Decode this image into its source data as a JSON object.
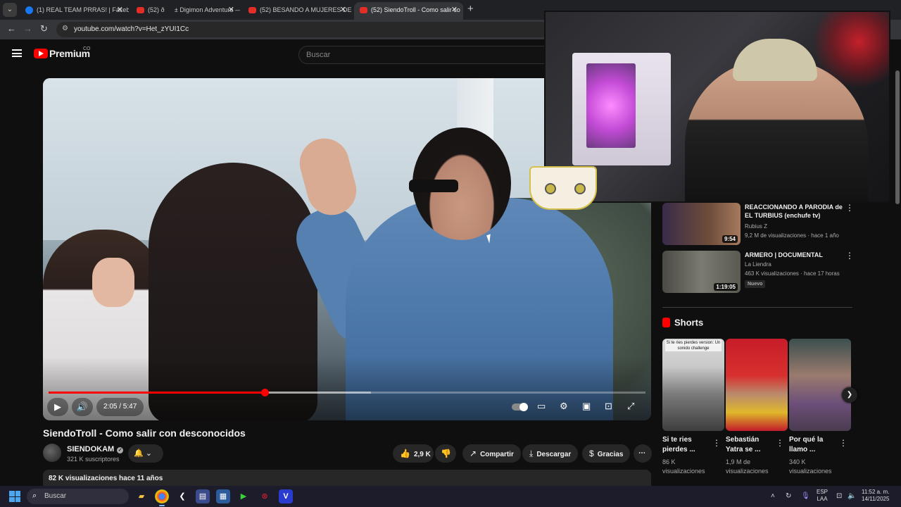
{
  "browser": {
    "tabs": [
      {
        "title": "(1) REAL TEAM PRRAS! | Facebo",
        "favicon": "facebook-icon",
        "active": false
      },
      {
        "title": "(52) ð± Digimon Adventure — B",
        "favicon": "youtube-icon",
        "active": false
      },
      {
        "title": "(52) BESANDO A MUJERES DESC",
        "favicon": "youtube-icon",
        "active": false
      },
      {
        "title": "(52) SiendoTroll - Como salir co",
        "favicon": "youtube-icon",
        "active": true
      }
    ],
    "url": "youtube.com/watch?v=Het_zYUI1Cc"
  },
  "yt": {
    "logo": "Premium",
    "country": "CO",
    "search_placeholder": "Buscar"
  },
  "player": {
    "time": "2:05 / 5:47",
    "progress": 0.362,
    "buffered": 0.54
  },
  "video": {
    "title": "SiendoTroll - Como salir con desconocidos",
    "channel": "SIENDOKAM",
    "subscribers": "321 K suscriptores",
    "likes": "2,9 K",
    "share": "Compartir",
    "download": "Descargar",
    "thanks": "Gracias",
    "views_date": "82 K visualizaciones  hace 11 años"
  },
  "recommended": [
    {
      "title": "REACCIONANDO A PARODIA de EL TURBIUS (enchufe tv)",
      "channel": "Rubius Z",
      "meta": "9,2 M de visualizaciones · hace 1 año",
      "duration": "9:54",
      "badge": ""
    },
    {
      "title": "ARMERO | DOCUMENTAL",
      "channel": "La Liendra",
      "meta": "463 K visualizaciones · hace 17 horas",
      "duration": "1:19:05",
      "badge": "Nuevo"
    }
  ],
  "shorts": {
    "heading": "Shorts",
    "items": [
      {
        "title": "Si te ries pierdes ...",
        "views": "86 K visualizaciones",
        "overlay": "Si te ries pierdes version: Un sonido challenge"
      },
      {
        "title": "Sebastián Yatra se ...",
        "views": "1,9 M de visualizaciones",
        "overlay": ""
      },
      {
        "title": "Por qué la llamo ...",
        "views": "340 K visualizaciones",
        "overlay": ""
      }
    ]
  },
  "taskbar": {
    "search_placeholder": "Buscar",
    "lang_line1": "ESP",
    "lang_line2": "LAA",
    "time": "11:52 a. m.",
    "date": "14/11/2025"
  },
  "colors": {
    "accent": "#ff0000",
    "background": "#0f0f0f"
  }
}
